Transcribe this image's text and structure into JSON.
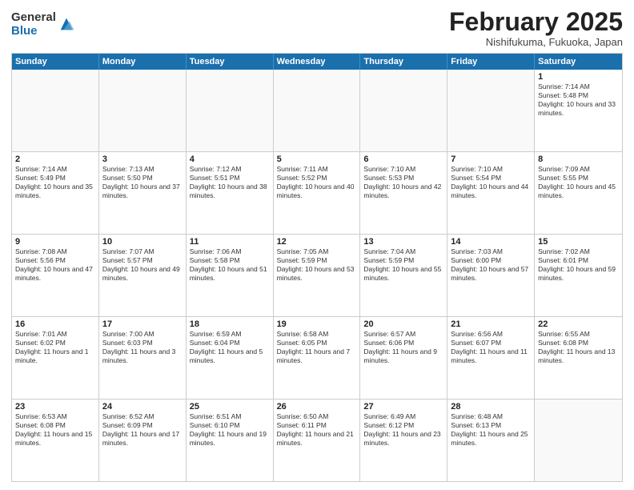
{
  "logo": {
    "general": "General",
    "blue": "Blue"
  },
  "header": {
    "month": "February 2025",
    "location": "Nishifukuma, Fukuoka, Japan"
  },
  "weekdays": [
    "Sunday",
    "Monday",
    "Tuesday",
    "Wednesday",
    "Thursday",
    "Friday",
    "Saturday"
  ],
  "rows": [
    [
      {
        "day": "",
        "text": ""
      },
      {
        "day": "",
        "text": ""
      },
      {
        "day": "",
        "text": ""
      },
      {
        "day": "",
        "text": ""
      },
      {
        "day": "",
        "text": ""
      },
      {
        "day": "",
        "text": ""
      },
      {
        "day": "1",
        "text": "Sunrise: 7:14 AM\nSunset: 5:48 PM\nDaylight: 10 hours and 33 minutes."
      }
    ],
    [
      {
        "day": "2",
        "text": "Sunrise: 7:14 AM\nSunset: 5:49 PM\nDaylight: 10 hours and 35 minutes."
      },
      {
        "day": "3",
        "text": "Sunrise: 7:13 AM\nSunset: 5:50 PM\nDaylight: 10 hours and 37 minutes."
      },
      {
        "day": "4",
        "text": "Sunrise: 7:12 AM\nSunset: 5:51 PM\nDaylight: 10 hours and 38 minutes."
      },
      {
        "day": "5",
        "text": "Sunrise: 7:11 AM\nSunset: 5:52 PM\nDaylight: 10 hours and 40 minutes."
      },
      {
        "day": "6",
        "text": "Sunrise: 7:10 AM\nSunset: 5:53 PM\nDaylight: 10 hours and 42 minutes."
      },
      {
        "day": "7",
        "text": "Sunrise: 7:10 AM\nSunset: 5:54 PM\nDaylight: 10 hours and 44 minutes."
      },
      {
        "day": "8",
        "text": "Sunrise: 7:09 AM\nSunset: 5:55 PM\nDaylight: 10 hours and 45 minutes."
      }
    ],
    [
      {
        "day": "9",
        "text": "Sunrise: 7:08 AM\nSunset: 5:56 PM\nDaylight: 10 hours and 47 minutes."
      },
      {
        "day": "10",
        "text": "Sunrise: 7:07 AM\nSunset: 5:57 PM\nDaylight: 10 hours and 49 minutes."
      },
      {
        "day": "11",
        "text": "Sunrise: 7:06 AM\nSunset: 5:58 PM\nDaylight: 10 hours and 51 minutes."
      },
      {
        "day": "12",
        "text": "Sunrise: 7:05 AM\nSunset: 5:59 PM\nDaylight: 10 hours and 53 minutes."
      },
      {
        "day": "13",
        "text": "Sunrise: 7:04 AM\nSunset: 5:59 PM\nDaylight: 10 hours and 55 minutes."
      },
      {
        "day": "14",
        "text": "Sunrise: 7:03 AM\nSunset: 6:00 PM\nDaylight: 10 hours and 57 minutes."
      },
      {
        "day": "15",
        "text": "Sunrise: 7:02 AM\nSunset: 6:01 PM\nDaylight: 10 hours and 59 minutes."
      }
    ],
    [
      {
        "day": "16",
        "text": "Sunrise: 7:01 AM\nSunset: 6:02 PM\nDaylight: 11 hours and 1 minute."
      },
      {
        "day": "17",
        "text": "Sunrise: 7:00 AM\nSunset: 6:03 PM\nDaylight: 11 hours and 3 minutes."
      },
      {
        "day": "18",
        "text": "Sunrise: 6:59 AM\nSunset: 6:04 PM\nDaylight: 11 hours and 5 minutes."
      },
      {
        "day": "19",
        "text": "Sunrise: 6:58 AM\nSunset: 6:05 PM\nDaylight: 11 hours and 7 minutes."
      },
      {
        "day": "20",
        "text": "Sunrise: 6:57 AM\nSunset: 6:06 PM\nDaylight: 11 hours and 9 minutes."
      },
      {
        "day": "21",
        "text": "Sunrise: 6:56 AM\nSunset: 6:07 PM\nDaylight: 11 hours and 11 minutes."
      },
      {
        "day": "22",
        "text": "Sunrise: 6:55 AM\nSunset: 6:08 PM\nDaylight: 11 hours and 13 minutes."
      }
    ],
    [
      {
        "day": "23",
        "text": "Sunrise: 6:53 AM\nSunset: 6:08 PM\nDaylight: 11 hours and 15 minutes."
      },
      {
        "day": "24",
        "text": "Sunrise: 6:52 AM\nSunset: 6:09 PM\nDaylight: 11 hours and 17 minutes."
      },
      {
        "day": "25",
        "text": "Sunrise: 6:51 AM\nSunset: 6:10 PM\nDaylight: 11 hours and 19 minutes."
      },
      {
        "day": "26",
        "text": "Sunrise: 6:50 AM\nSunset: 6:11 PM\nDaylight: 11 hours and 21 minutes."
      },
      {
        "day": "27",
        "text": "Sunrise: 6:49 AM\nSunset: 6:12 PM\nDaylight: 11 hours and 23 minutes."
      },
      {
        "day": "28",
        "text": "Sunrise: 6:48 AM\nSunset: 6:13 PM\nDaylight: 11 hours and 25 minutes."
      },
      {
        "day": "",
        "text": ""
      }
    ]
  ]
}
